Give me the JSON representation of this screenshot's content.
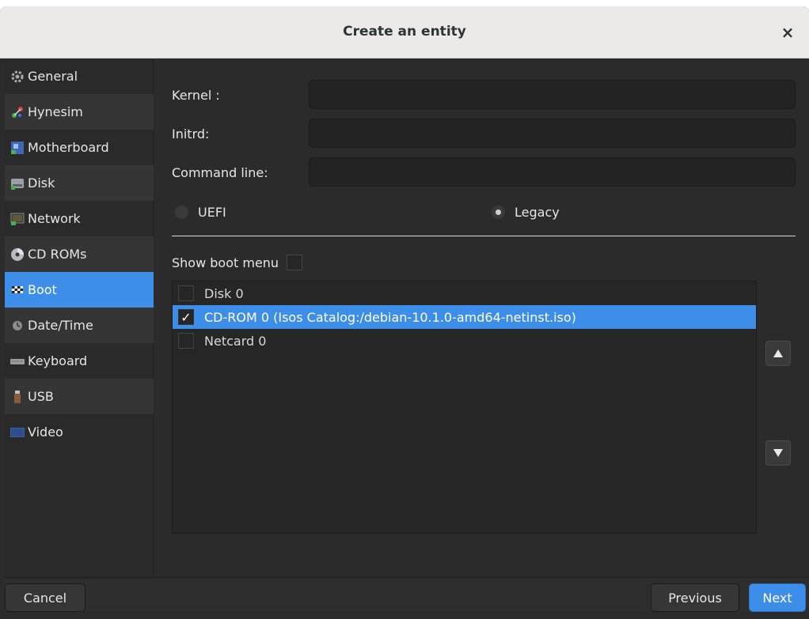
{
  "window": {
    "title": "Create an entity",
    "close_glyph": "×"
  },
  "sidebar": {
    "items": [
      {
        "label": "General",
        "icon": "gear-icon",
        "selected": false
      },
      {
        "label": "Hynesim",
        "icon": "hynesim-icon",
        "selected": false
      },
      {
        "label": "Motherboard",
        "icon": "motherboard-icon",
        "selected": false
      },
      {
        "label": "Disk",
        "icon": "disk-icon",
        "selected": false
      },
      {
        "label": "Network",
        "icon": "network-icon",
        "selected": false
      },
      {
        "label": "CD ROMs",
        "icon": "cdrom-icon",
        "selected": false
      },
      {
        "label": "Boot",
        "icon": "checkered-flag-icon",
        "selected": true
      },
      {
        "label": "Date/Time",
        "icon": "clock-icon",
        "selected": false
      },
      {
        "label": "Keyboard",
        "icon": "keyboard-icon",
        "selected": false
      },
      {
        "label": "USB",
        "icon": "usb-icon",
        "selected": false
      },
      {
        "label": "Video",
        "icon": "monitor-icon",
        "selected": false
      }
    ]
  },
  "boot": {
    "kernel_label": "Kernel :",
    "kernel_value": "",
    "initrd_label": "Initrd:",
    "initrd_value": "",
    "cmdline_label": "Command line:",
    "cmdline_value": "",
    "uefi_label": "UEFI",
    "legacy_label": "Legacy",
    "selected_mode": "Legacy",
    "show_boot_menu_label": "Show boot menu",
    "show_boot_menu_checked": false,
    "order": [
      {
        "label": "Disk 0",
        "checked": false,
        "selected": false
      },
      {
        "label": "CD-ROM 0 (Isos Catalog:/debian-10.1.0-amd64-netinst.iso)",
        "checked": true,
        "selected": true
      },
      {
        "label": "Netcard 0",
        "checked": false,
        "selected": false
      }
    ],
    "check_glyph": "✓",
    "move_up_icon": "triangle-up-icon",
    "move_down_icon": "triangle-down-icon"
  },
  "footer": {
    "cancel": "Cancel",
    "previous": "Previous",
    "next": "Next"
  },
  "colors": {
    "accent": "#3d8ee8",
    "titlebar": "#ebeae8",
    "background": "#2b2b2b"
  }
}
